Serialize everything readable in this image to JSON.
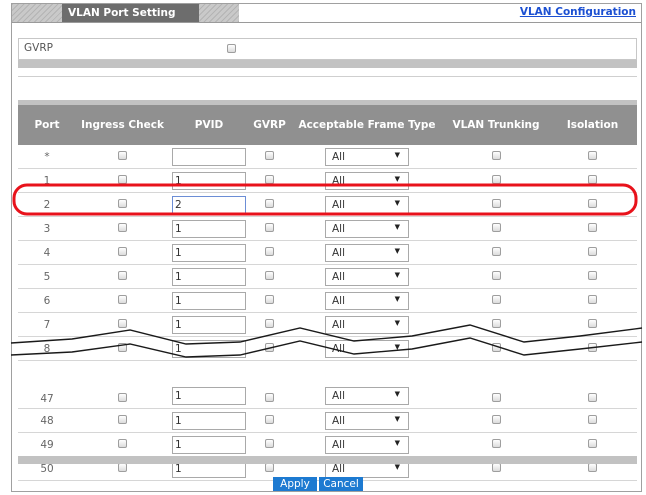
{
  "header": {
    "tab_title": "VLAN Port Setting",
    "link_label": "VLAN Configuration"
  },
  "gvrp": {
    "label": "GVRP",
    "checked": false
  },
  "table": {
    "columns": [
      "Port",
      "Ingress Check",
      "PVID",
      "GVRP",
      "Acceptable Frame Type",
      "VLAN Trunking",
      "Isolation"
    ],
    "rows": [
      {
        "port": "*",
        "pvid": "",
        "frame_type": "All"
      },
      {
        "port": "1",
        "pvid": "1",
        "frame_type": "All"
      },
      {
        "port": "2",
        "pvid": "2",
        "frame_type": "All",
        "highlighted": true
      },
      {
        "port": "3",
        "pvid": "1",
        "frame_type": "All"
      },
      {
        "port": "4",
        "pvid": "1",
        "frame_type": "All"
      },
      {
        "port": "5",
        "pvid": "1",
        "frame_type": "All"
      },
      {
        "port": "6",
        "pvid": "1",
        "frame_type": "All"
      },
      {
        "port": "7",
        "pvid": "1",
        "frame_type": "All"
      },
      {
        "port": "8",
        "pvid": "1",
        "frame_type": "All"
      },
      {
        "port": "47",
        "pvid": "1",
        "frame_type": "All"
      },
      {
        "port": "48",
        "pvid": "1",
        "frame_type": "All"
      },
      {
        "port": "49",
        "pvid": "1",
        "frame_type": "All"
      },
      {
        "port": "50",
        "pvid": "1",
        "frame_type": "All"
      }
    ]
  },
  "buttons": {
    "apply": "Apply",
    "cancel": "Cancel"
  },
  "colors": {
    "header_bg": "#909090",
    "tab_bg": "#6d6d6d",
    "link": "#1c50d2",
    "button": "#1d7ad1",
    "highlight": "#e8121b"
  },
  "icons": {
    "select_arrow": "▼"
  }
}
